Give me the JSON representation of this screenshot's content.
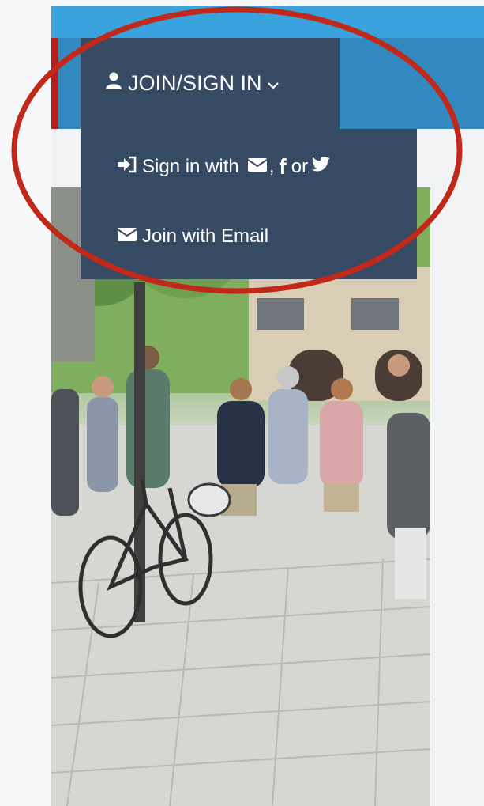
{
  "nav": {
    "join_label": "JOIN/SIGN IN",
    "icons": {
      "user": "user-icon",
      "chevron": "chevron-down-icon"
    }
  },
  "dropdown": {
    "signin": {
      "prefix": "Sign in with",
      "sep": ",",
      "facebook": "f",
      "or": "or",
      "icons": [
        "sign-in-icon",
        "envelope-icon",
        "facebook-icon",
        "twitter-icon"
      ]
    },
    "join": {
      "label": "Join with Email",
      "icon": "envelope-icon"
    }
  },
  "colors": {
    "nav_blue": "#3289bf",
    "top_blue": "#3aa3de",
    "dark_slate": "#374a64",
    "annotation_red": "#c0281a"
  }
}
